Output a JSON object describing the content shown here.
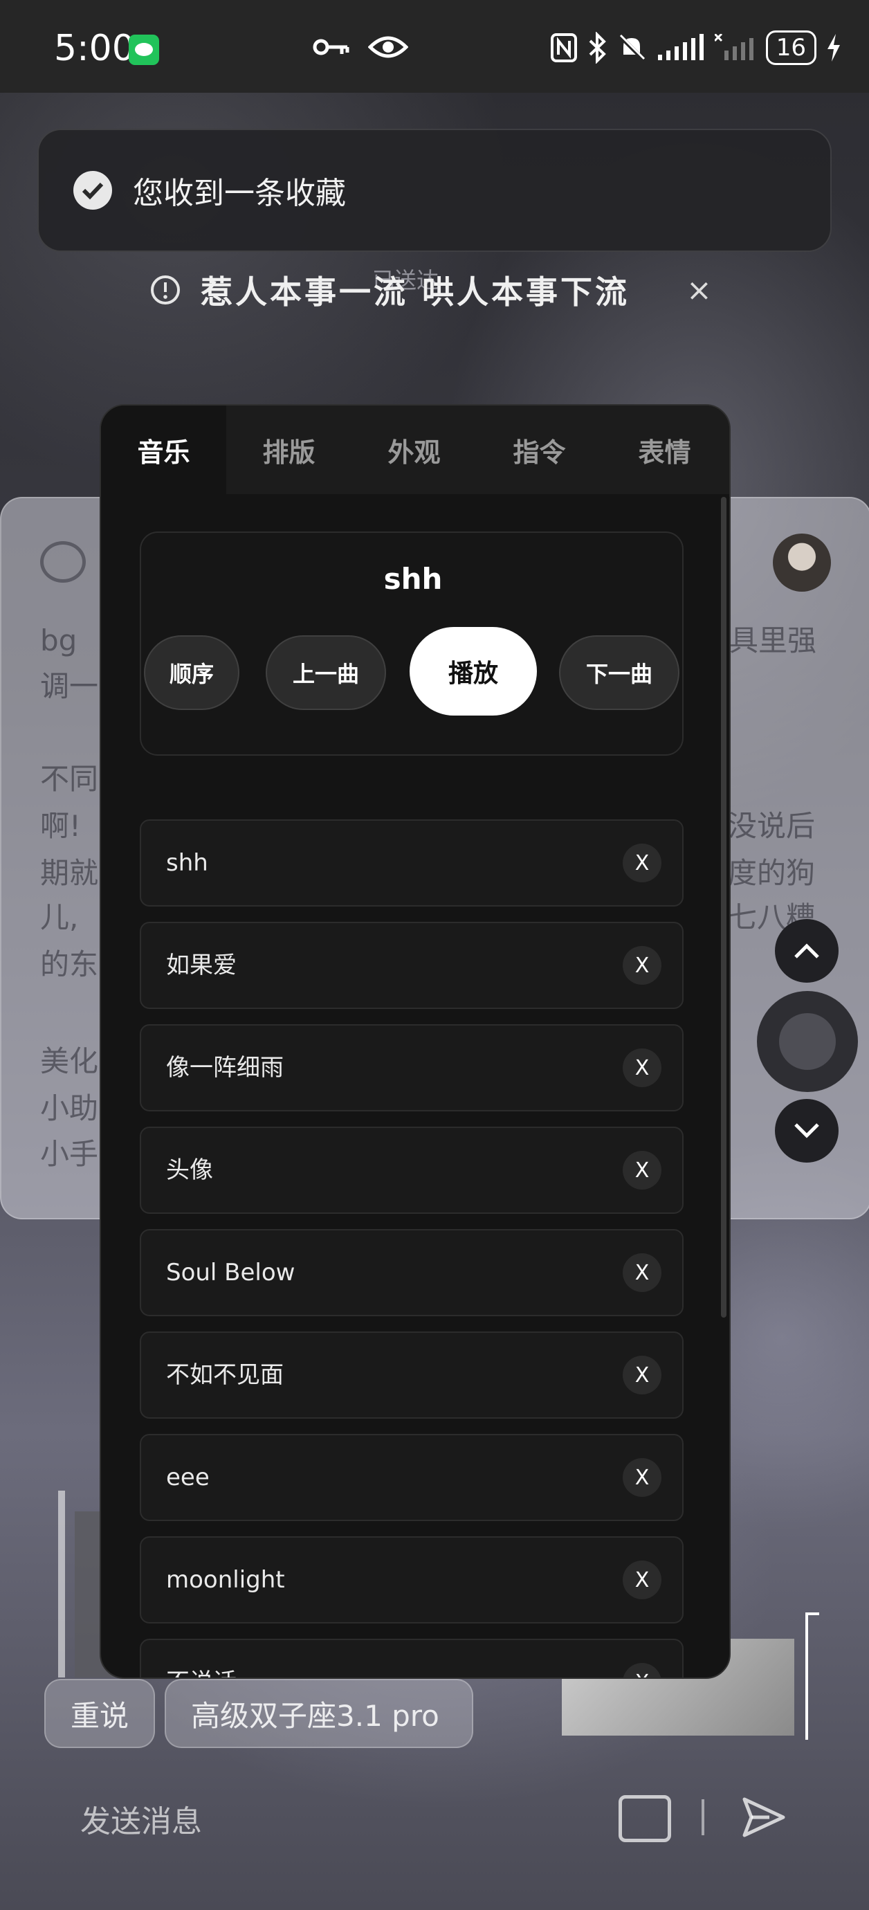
{
  "status_bar": {
    "time": "5:00",
    "battery": "16"
  },
  "notification": {
    "text": "您收到一条收藏"
  },
  "toast": {
    "text": "惹人本事一流 哄人本事下流",
    "close": "×",
    "delivered": "已送达"
  },
  "background": {
    "card_lines": [
      "bg",
      "调一",
      "不同",
      "啊!",
      "期就",
      "儿,",
      "的东",
      "美化",
      "小助",
      "小手"
    ],
    "card_right_lines": [
      "具里强",
      "没说后",
      "度的狗",
      "七八糟"
    ],
    "bottom_chips": [
      "重说",
      "高级双子座3.1 pro"
    ],
    "input_placeholder": "发送消息"
  },
  "panel": {
    "tabs": [
      "音乐",
      "排版",
      "外观",
      "指令",
      "表情"
    ],
    "active_tab": 0,
    "player": {
      "current_song": "shh",
      "controls": {
        "order": "顺序",
        "prev": "上一曲",
        "play": "播放",
        "next": "下一曲"
      }
    },
    "playlist": [
      {
        "name": "shh",
        "remove": "X"
      },
      {
        "name": "如果爱",
        "remove": "X"
      },
      {
        "name": "像一阵细雨",
        "remove": "X"
      },
      {
        "name": "头像",
        "remove": "X"
      },
      {
        "name": "Soul Below",
        "remove": "X"
      },
      {
        "name": "不如不见面",
        "remove": "X"
      },
      {
        "name": "eee",
        "remove": "X"
      },
      {
        "name": "moonlight",
        "remove": "X"
      },
      {
        "name": "不说话",
        "remove": "X"
      }
    ]
  }
}
